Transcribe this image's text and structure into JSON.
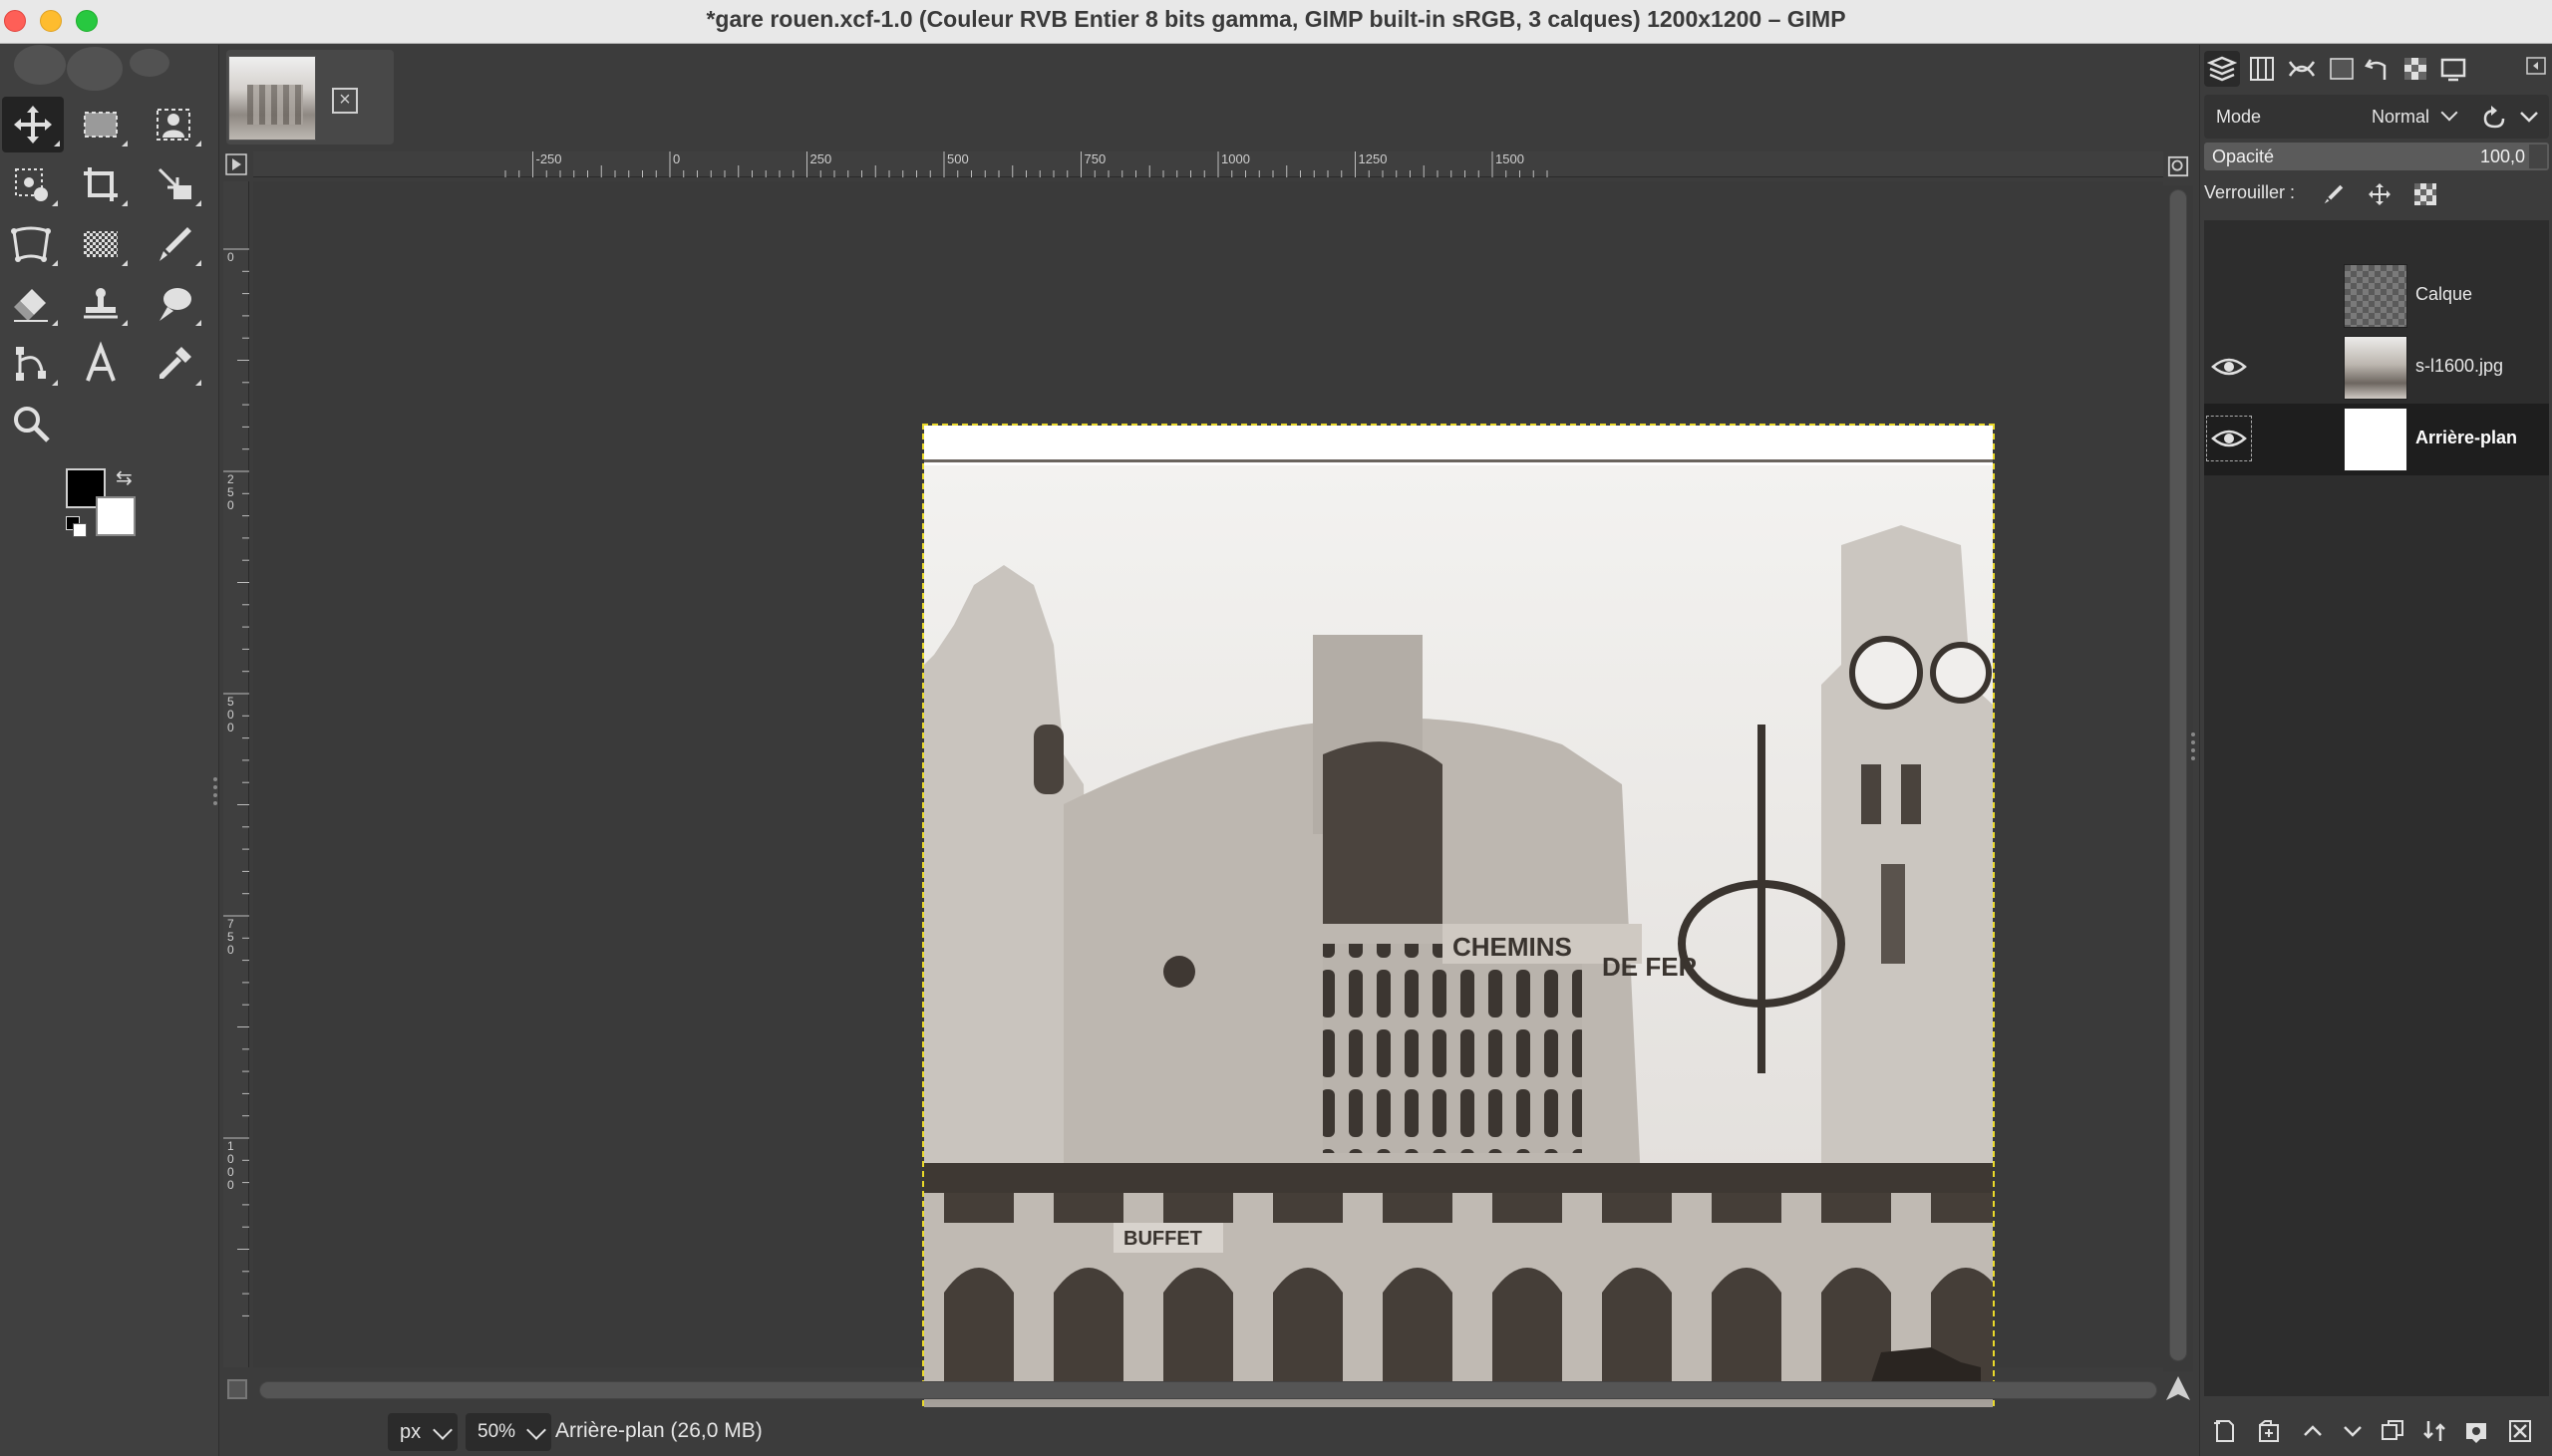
{
  "window": {
    "title": "*gare rouen.xcf-1.0 (Couleur RVB Entier 8 bits gamma, GIMP built-in sRGB, 3 calques) 1200x1200 – GIMP"
  },
  "toolbox": {
    "tools": [
      {
        "name": "move-tool-icon"
      },
      {
        "name": "rect-select-tool-icon"
      },
      {
        "name": "foreground-select-tool-icon"
      },
      {
        "name": "fuzzy-select-tool-icon"
      },
      {
        "name": "crop-tool-icon"
      },
      {
        "name": "scale-tool-icon"
      },
      {
        "name": "warp-transform-tool-icon"
      },
      {
        "name": "gradient-tool-icon"
      },
      {
        "name": "paintbrush-tool-icon"
      },
      {
        "name": "eraser-tool-icon"
      },
      {
        "name": "clone-tool-icon"
      },
      {
        "name": "smudge-tool-icon"
      },
      {
        "name": "paths-tool-icon"
      },
      {
        "name": "text-tool-icon"
      },
      {
        "name": "color-picker-tool-icon"
      },
      {
        "name": "zoom-tool-icon"
      }
    ],
    "fg_color": "#000000",
    "bg_color": "#ffffff"
  },
  "rulers": {
    "horizontal": [
      "-250",
      "0",
      "250",
      "500",
      "750",
      "1000",
      "1250",
      "1500"
    ],
    "vertical": [
      "0",
      "250",
      "500",
      "750",
      "1000"
    ]
  },
  "canvas": {
    "layer_colors": {
      "sky": "#ebe9e6",
      "stone": "#b7b1aa",
      "shadow": "#3c3631"
    }
  },
  "statusbar": {
    "unit": "px",
    "zoom": "50%",
    "status_text": "Arrière-plan (26,0 MB)"
  },
  "layers_panel": {
    "mode_label": "Mode",
    "mode_value": "Normal",
    "opacity_label": "Opacité",
    "opacity_value": "100,0",
    "lock_label": "Verrouiller :",
    "layers": [
      {
        "name": "Calque",
        "visible": false,
        "thumb": "transparent",
        "selected": false
      },
      {
        "name": "s-l1600.jpg",
        "visible": true,
        "thumb": "photo",
        "selected": false
      },
      {
        "name": "Arrière-plan",
        "visible": true,
        "thumb": "white",
        "selected": true
      }
    ]
  }
}
